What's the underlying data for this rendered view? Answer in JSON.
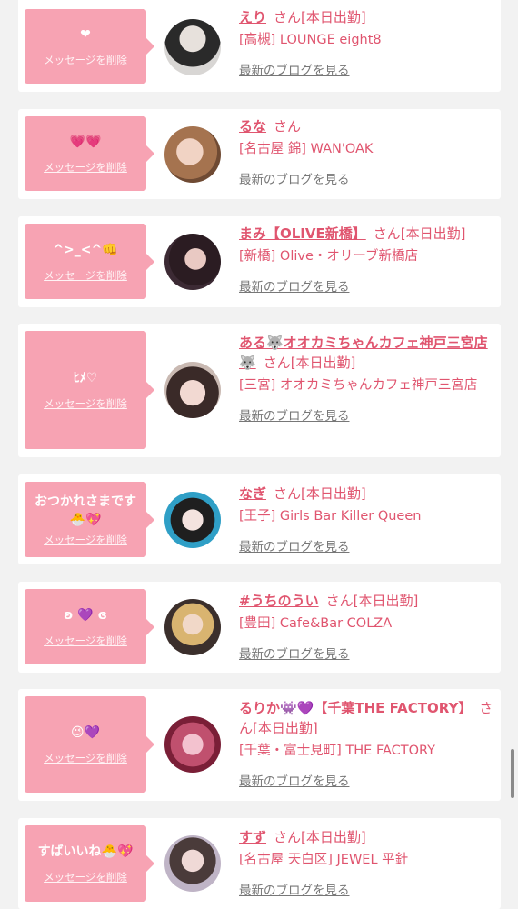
{
  "delete_label": "メッセージを削除",
  "blog_label": "最新のブログを見る",
  "san_label": "さん",
  "cards": [
    {
      "message": "❤",
      "name": "えり",
      "status": "[本日出勤]",
      "shop": "[高槻] LOUNGE eight8"
    },
    {
      "message": "💗💗",
      "name": "るな",
      "status": "",
      "shop": "[名古屋 錦] WAN'OAK"
    },
    {
      "message": "^>_<^👊",
      "name": "まみ【OLIVE新橋】",
      "status": "[本日出勤]",
      "shop": "[新橋] Olive・オリーブ新橋店"
    },
    {
      "message": "ﾋﾒ♡",
      "name": "ある🐺オオカミちゃんカフェ神戸三宮店🐺",
      "status": "[本日出勤]",
      "shop": "[三宮] オオカミちゃんカフェ神戸三宮店"
    },
    {
      "message": "おつかれさまです🐣💖",
      "name": "なぎ",
      "status": "[本日出勤]",
      "shop": "[王子] Girls Bar Killer Queen"
    },
    {
      "message": "ʚ 💜 ɞ",
      "name": "#うちのうい",
      "status": "[本日出勤]",
      "shop": "[豊田] Cafe&Bar COLZA"
    },
    {
      "message": "😉💜",
      "name": "るりか👾💜【千葉THE FACTORY】",
      "status": "[本日出勤]",
      "shop": "[千葉・富士見町] THE FACTORY"
    },
    {
      "message": "すばいいね🐣💖",
      "name": "すず",
      "status": "[本日出勤]",
      "shop": "[名古屋 天白区] JEWEL 平針"
    }
  ]
}
